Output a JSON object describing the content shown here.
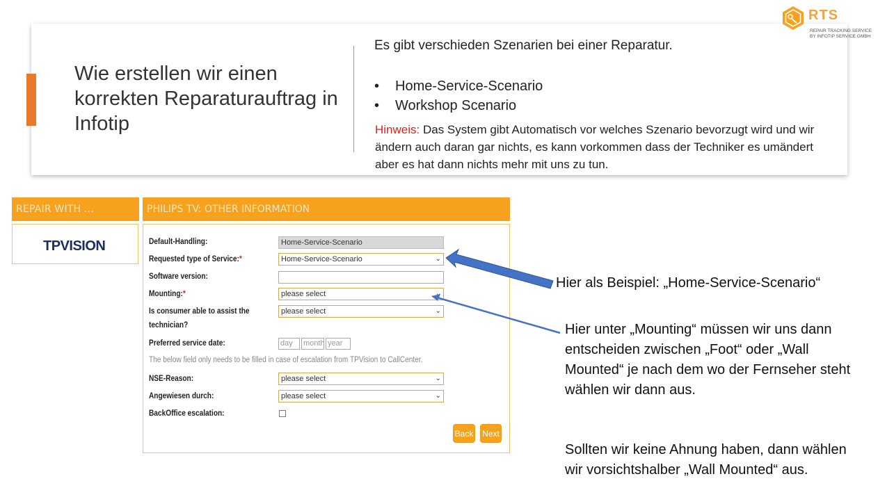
{
  "slide": {
    "title": "Wie erstellen wir einen korrekten Reparaturauftrag in Infotip",
    "intro": "Es gibt verschieden Szenarien bei einer Reparatur.",
    "scenarios": [
      "Home-Service-Scenario",
      "Workshop Scenario"
    ],
    "hint_label": "Hinweis:",
    "hint_text": " Das System gibt Automatisch vor welches Szenario bevorzugt wird und wir ändern auch daran gar nichts, es kann vorkommen dass der Techniker es umändert aber es hat dann nichts mehr mit uns zu tun.",
    "accent_color": "#e87a2c"
  },
  "logo": {
    "name": "RTS",
    "subtitle_line1": "REPAIR TRACKING SERVICE",
    "subtitle_line2": "BY INFOTIP SERVICE GMBH"
  },
  "app": {
    "repair_header": "REPAIR WITH ...",
    "brand_logo": "TPVISION",
    "form_header": "PHILIPS TV: OTHER INFORMATION",
    "header_color": "#f7a21e",
    "fields": {
      "default_handling_label": "Default-Handling:",
      "default_handling_value": "Home-Service-Scenario",
      "service_type_label": "Requested type of Service:",
      "service_type_value": "Home-Service-Scenario",
      "software_label": "Software version:",
      "software_value": "",
      "mounting_label": "Mounting:",
      "mounting_value": "please select",
      "consumer_label_line1": "Is consumer able to assist the",
      "consumer_label_line2": "technician?",
      "consumer_value": "please select",
      "preferred_date_label": "Preferred service date:",
      "date_day_placeholder": "day",
      "date_month_placeholder": "month",
      "date_year_placeholder": "year",
      "escalation_note": "The below field only needs to be filled in case of escalation from TPVision to CallCenter.",
      "nse_label": "NSE-Reason:",
      "nse_value": "please select",
      "angewiesen_label": "Angewiesen durch:",
      "angewiesen_value": "please select",
      "backoffice_label": "BackOffice escalation:",
      "backoffice_checked": false
    },
    "buttons": {
      "back": "Back",
      "next": "Next"
    }
  },
  "annotations": {
    "example": "Hier als Beispiel: „Home-Service-Scenario“",
    "mounting_explanation": "Hier unter „Mounting“ müssen wir uns dann entscheiden zwischen „Foot“ oder „Wall Mounted“ je nach dem wo der Fernseher steht wählen wir dann aus.",
    "advice": "Sollten wir keine Ahnung haben, dann wählen wir vorsichtshalber „Wall Mounted“ aus.",
    "arrow_color": "#4472c4"
  }
}
